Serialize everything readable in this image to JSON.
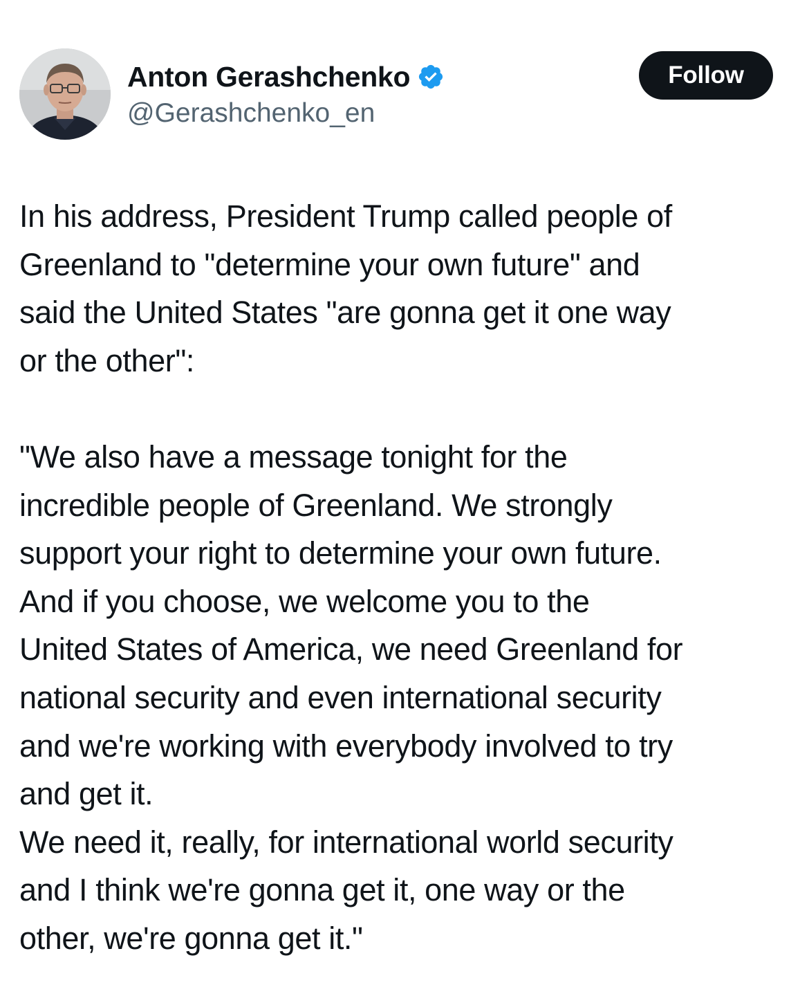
{
  "author": {
    "display_name": "Anton Gerashchenko",
    "handle": "@Gerashchenko_en",
    "verified": true,
    "avatar_icon": "profile-photo"
  },
  "follow_button": {
    "label": "Follow"
  },
  "tweet": {
    "lines": [
      "In his address, President Trump called people of",
      "Greenland to \"determine your own future\" and",
      "said the United States \"are gonna get it one way",
      "or the other\":",
      "",
      "\"We also have a message tonight for the",
      "incredible people of Greenland. We strongly",
      "support your right to determine your own future.",
      "And if you choose, we welcome you to the",
      "United States of America, we need Greenland for",
      "national security and even international security",
      "and we're working with everybody involved to try",
      "and get it.",
      "We need it, really, for international world security",
      "and I think we're gonna get it, one way or the",
      "other, we're gonna get it.\""
    ]
  },
  "colors": {
    "text": "#0f1419",
    "secondary_text": "#536471",
    "verified_badge": "#1d9bf0",
    "follow_button_bg": "#0f1419",
    "follow_button_text": "#ffffff"
  }
}
